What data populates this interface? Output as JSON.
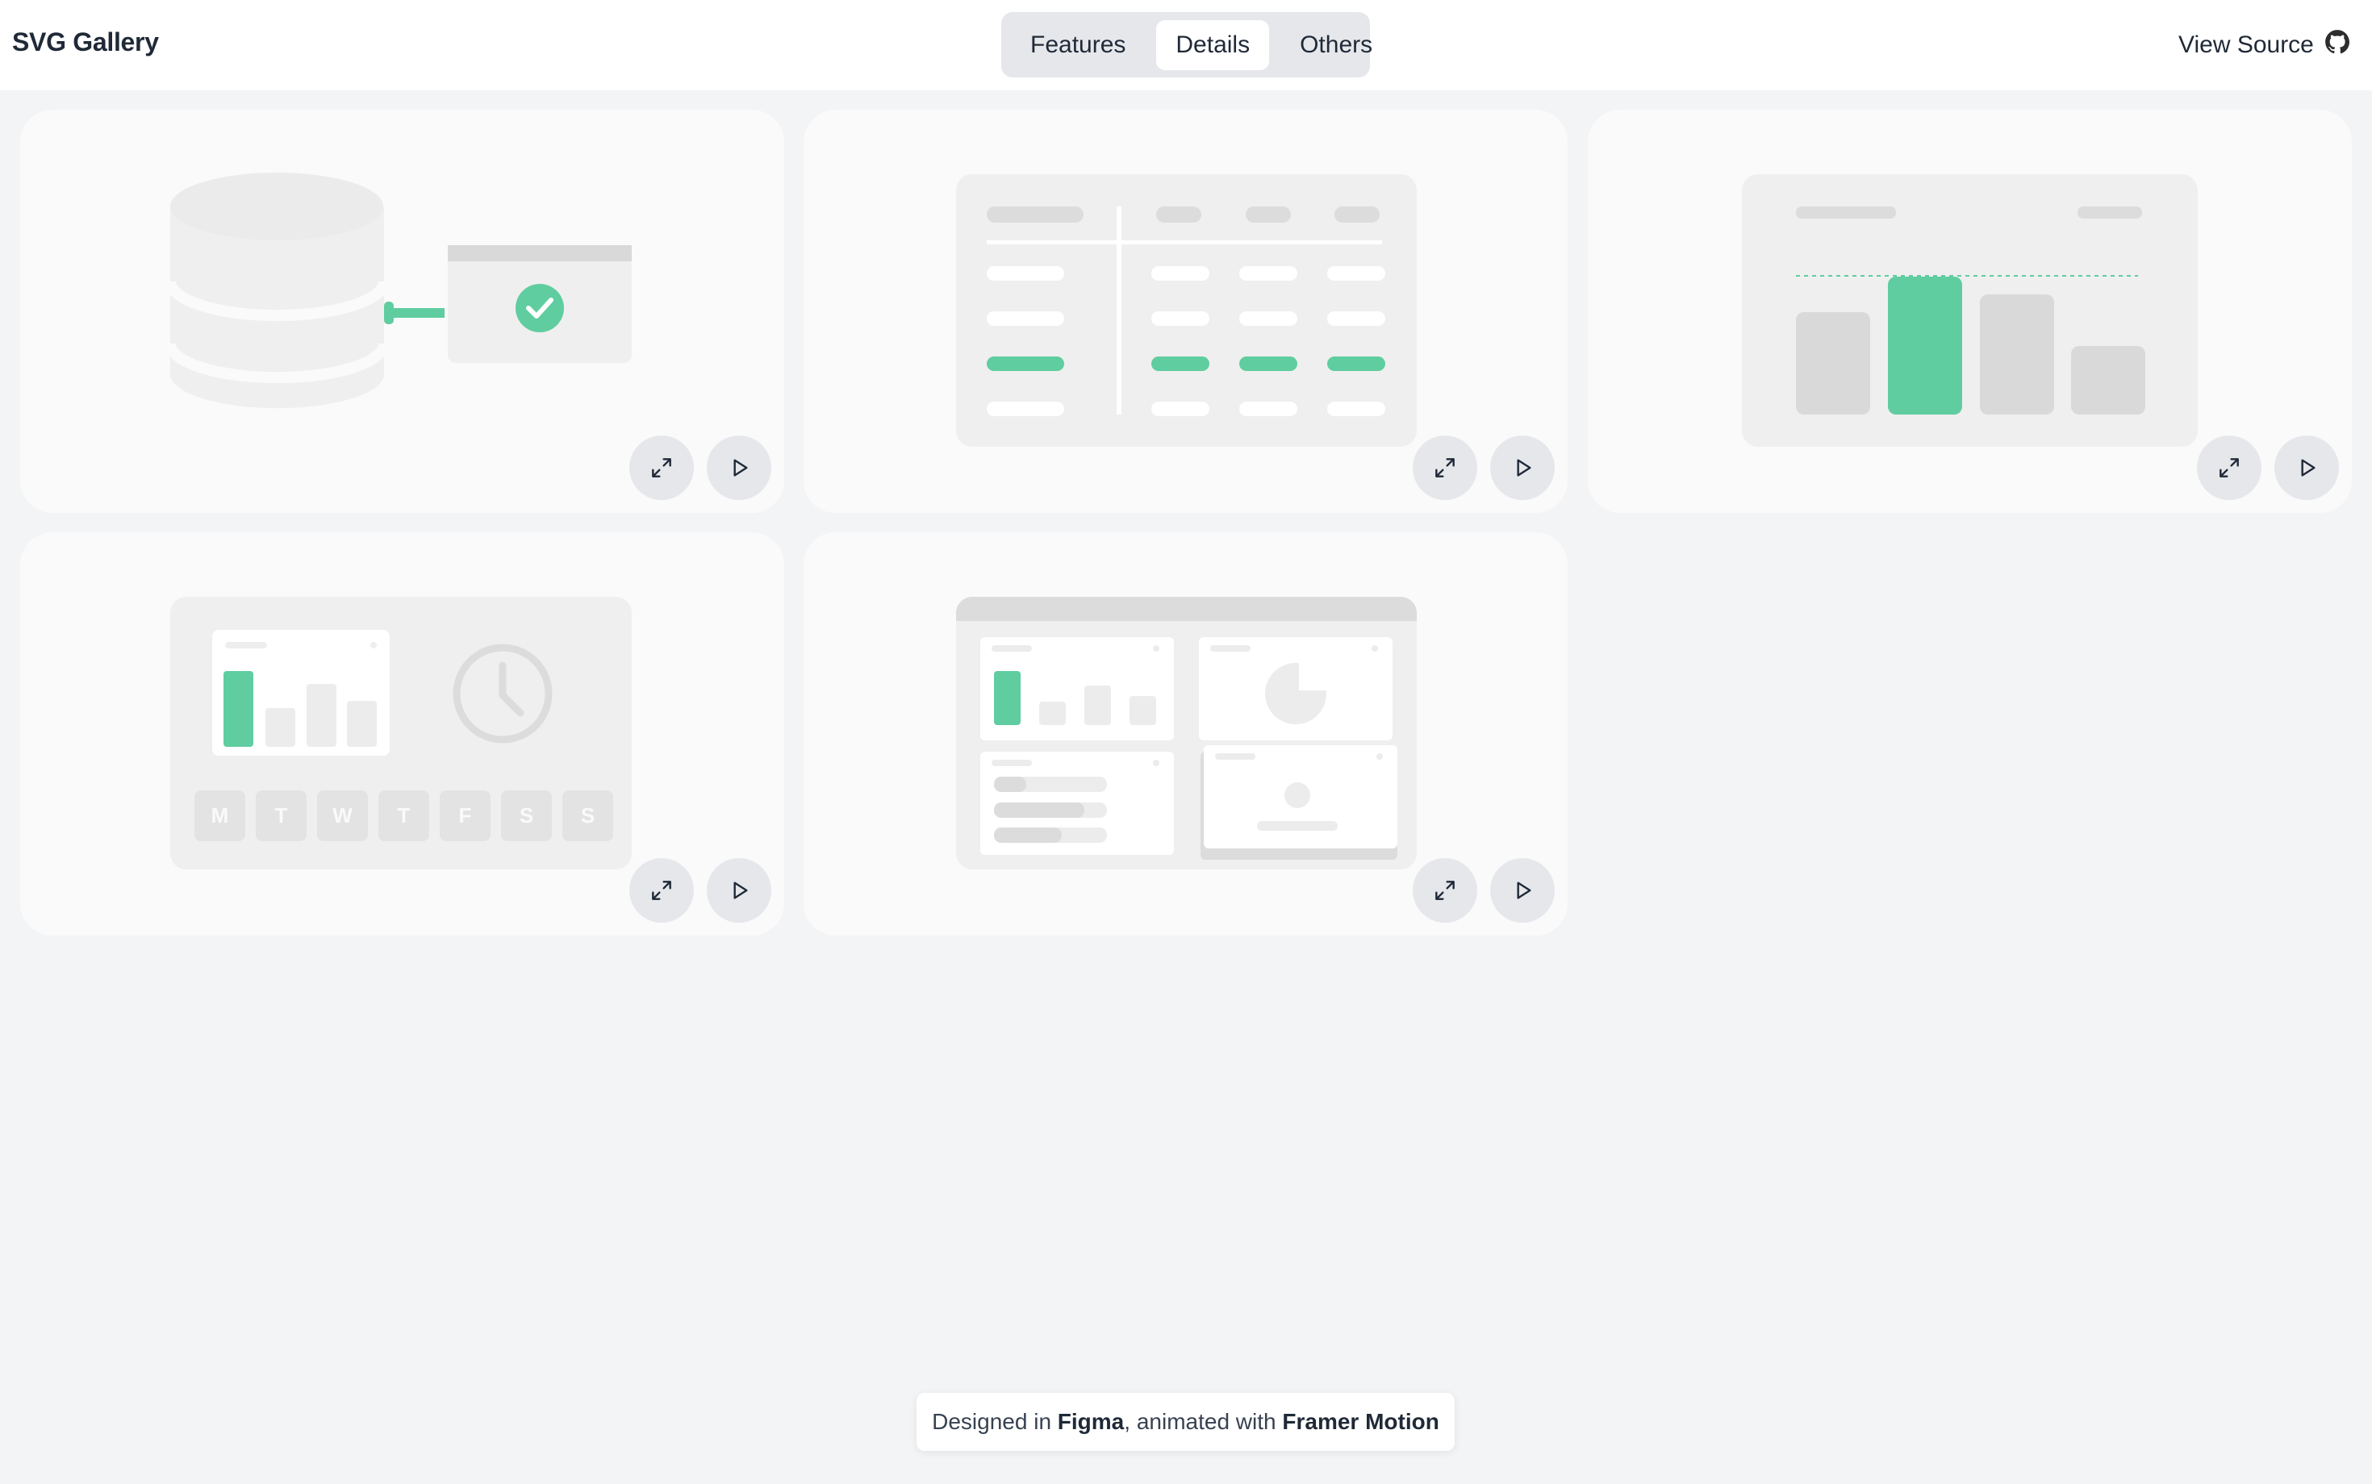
{
  "header": {
    "brand": "SVG Gallery",
    "tabs": [
      {
        "label": "Features",
        "active": false
      },
      {
        "label": "Details",
        "active": true
      },
      {
        "label": "Others",
        "active": false
      }
    ],
    "view_source_label": "View Source",
    "view_source_icon": "github-icon"
  },
  "gallery": {
    "calendar_days": [
      "M",
      "T",
      "W",
      "T",
      "F",
      "S",
      "S"
    ]
  },
  "footer": {
    "prefix": "Designed in ",
    "tool1": "Figma",
    "middle": ", animated with ",
    "tool2": "Framer Motion"
  },
  "colors": {
    "accent": "#5fcda0",
    "card_bg": "#fafafa",
    "page_bg": "#f3f4f6",
    "placeholder": "#d9d9d9"
  }
}
